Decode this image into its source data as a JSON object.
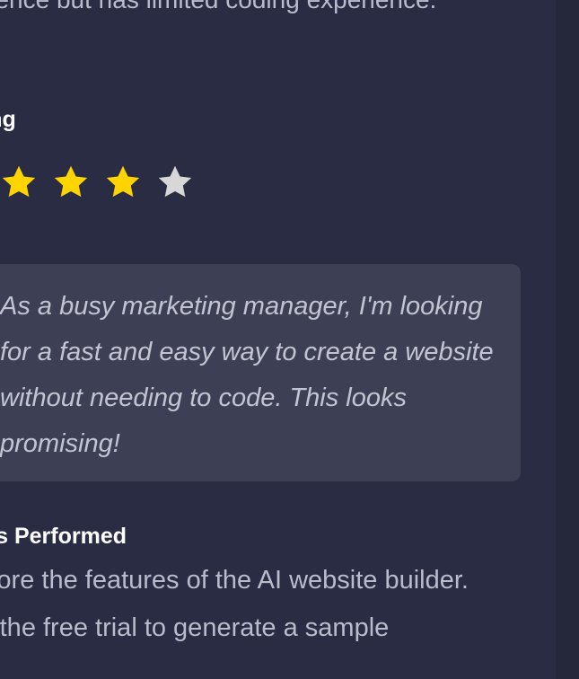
{
  "persona_card": {
    "background_text": "presence but has limited coding experience.",
    "rating": {
      "title": "Rating",
      "value": 4,
      "max": 5,
      "filled_color": "#ffd400",
      "empty_color": "#d7d7d7"
    },
    "quote": "As a busy marketing manager, I'm looking for a fast and easy way to create a website without needing to code. This looks promising!",
    "tasks": {
      "title": "Tasks Performed",
      "items": [
        "Explore the features of the AI website builder.",
        "Use the free trial to generate a sample"
      ]
    }
  },
  "icons": {
    "star": "star-icon"
  }
}
